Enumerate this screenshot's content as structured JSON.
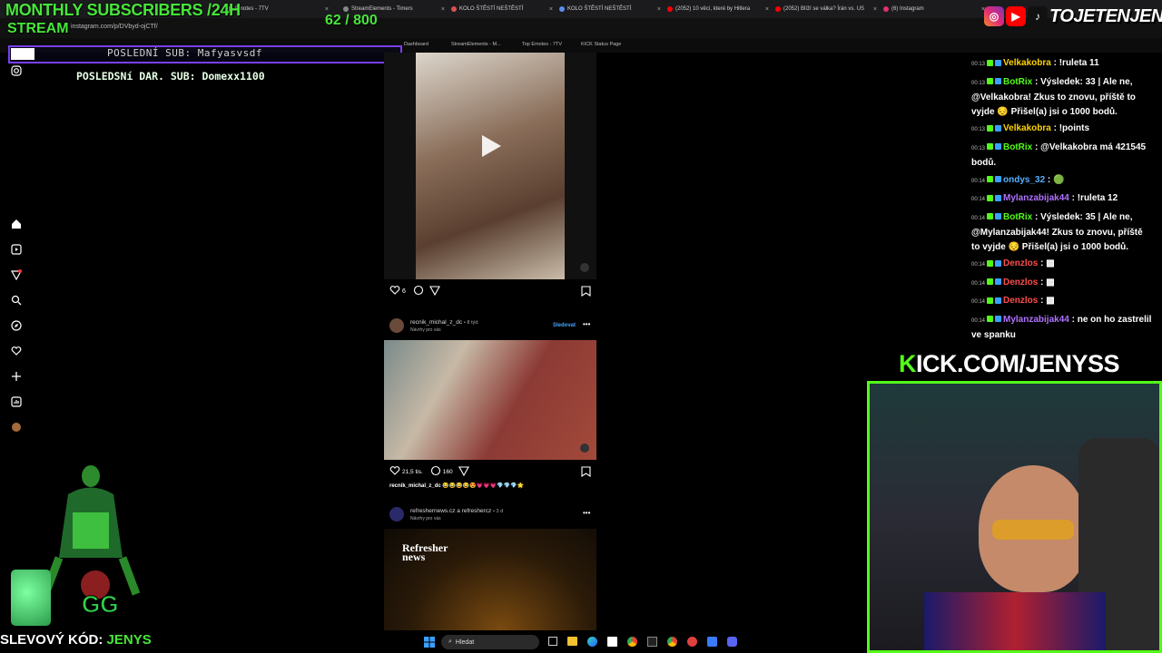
{
  "overlay": {
    "title": "MONTHLY SUBSCRIBERS /24H",
    "stream_label": "STREAM",
    "counter": "62 / 800",
    "last_sub": "POSLEDNÍ SUB: Mafyasvsdf",
    "last_gift_sub": "POSLEDSNí DAR. SUB: Domexx1100",
    "kick_prefix": "K",
    "kick_url_rest": "ICK.COM/JENYSS",
    "promo_label": "SLEVOVÝ KÓD: ",
    "promo_code": "JENYS",
    "social_handle": "TOJETENJENYS"
  },
  "browser": {
    "url": "instagram.com/p/DVbyd-ojCTf/",
    "tabs": [
      {
        "label": "Emotes - 7TV",
        "color": "#888888"
      },
      {
        "label": "StreamElements - Timers",
        "color": "#888888"
      },
      {
        "label": "KOLO ŠTĚSTÍ NEŠTĚSTÍ",
        "color": "#d9534f"
      },
      {
        "label": "KOLO ŠTĚSTÍ NEŠTĚSTÍ",
        "color": "#5b8def"
      },
      {
        "label": "(2052) 10 věcí, které by Hitlera",
        "color": "#ff0000"
      },
      {
        "label": "(2052) Blíží se válka? Írán vs. US",
        "color": "#ff0000"
      },
      {
        "label": "(6) Instagram",
        "color": "#e1306c"
      }
    ],
    "bookmarks": [
      "Dashboard",
      "StreamElements - M...",
      "Top Emotes - 7TV",
      "KICK Status Page"
    ]
  },
  "feed": {
    "post1": {
      "likes": "6"
    },
    "post2": {
      "user": "recnik_michal_z_dc",
      "age": "• 8 týd.",
      "subtitle": "Návrhy pro vás",
      "follow": "Sledovat",
      "likes": "21,5 tis.",
      "comments": "160",
      "caption_user": "recnik_michal_z_dc",
      "caption_emojis": "😂😂😂😂😍💗💗💗💎💎💎🌟"
    },
    "post3": {
      "user": "refreshernews.cz a refreshercz",
      "age": "• 3 d",
      "subtitle": "Návrhy pro vás",
      "logo_line1": "Refresher",
      "logo_line2": "news"
    }
  },
  "chat": [
    {
      "time": "00:13",
      "user": "Velkakobra",
      "color": "#ffd400",
      "text": "!ruleta 11"
    },
    {
      "time": "00:13",
      "user": "BotRix",
      "color": "#53fc18",
      "text": "Výsledek: 33 | Ale ne, @Velkakobra! Zkus to znovu, příště to vyjde 😔 Přišel(a) jsi o 1000 bodů."
    },
    {
      "time": "00:13",
      "user": "Velkakobra",
      "color": "#ffd400",
      "text": "!points"
    },
    {
      "time": "00:13",
      "user": "BotRix",
      "color": "#53fc18",
      "text": "@Velkakobra má 421545 bodů."
    },
    {
      "time": "00:14",
      "user": "ondys_32",
      "color": "#56b0ff",
      "text": "🟢"
    },
    {
      "time": "00:14",
      "user": "Mylanzabijak44",
      "color": "#b072ff",
      "text": "!ruleta 12"
    },
    {
      "time": "00:14",
      "user": "BotRix",
      "color": "#53fc18",
      "text": "Výsledek: 35 | Ale ne, @Mylanzabijak44! Zkus to znovu, příště to vyjde 😔 Přišel(a) jsi o 1000 bodů."
    },
    {
      "time": "00:14",
      "user": "Denzlos",
      "color": "#ff4d4d",
      "text": "▩"
    },
    {
      "time": "00:14",
      "user": "Denzlos",
      "color": "#ff4d4d",
      "text": "▩"
    },
    {
      "time": "00:14",
      "user": "Denzlos",
      "color": "#ff4d4d",
      "text": "▩"
    },
    {
      "time": "00:14",
      "user": "Mylanzabijak44",
      "color": "#b072ff",
      "text": "ne on ho zastrelil ve spanku"
    }
  ],
  "taskbar": {
    "search_placeholder": "Hledat"
  }
}
